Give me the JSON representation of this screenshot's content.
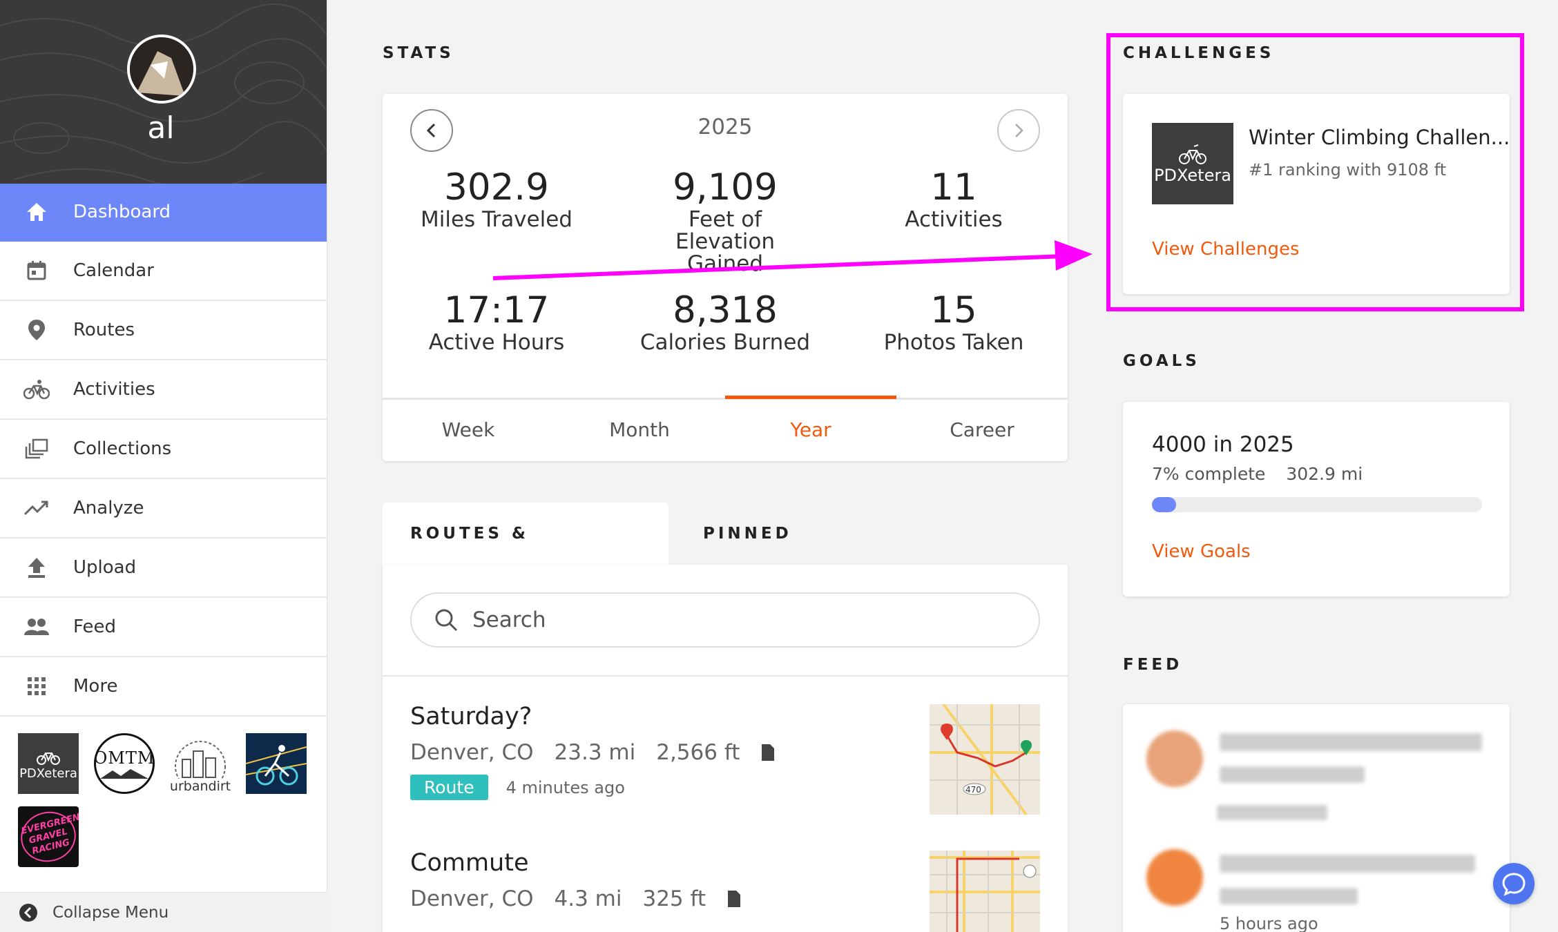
{
  "profile": {
    "username": "al"
  },
  "nav": [
    {
      "label": "Dashboard",
      "icon": "home-icon",
      "active": true
    },
    {
      "label": "Calendar",
      "icon": "calendar-icon"
    },
    {
      "label": "Routes",
      "icon": "map-pin-icon"
    },
    {
      "label": "Activities",
      "icon": "bike-icon"
    },
    {
      "label": "Collections",
      "icon": "collections-icon"
    },
    {
      "label": "Analyze",
      "icon": "trend-icon"
    },
    {
      "label": "Upload",
      "icon": "upload-icon"
    },
    {
      "label": "Feed",
      "icon": "people-icon"
    },
    {
      "label": "More",
      "icon": "grid-icon"
    }
  ],
  "clubs": [
    {
      "name": "PDXetera",
      "bg": "#3d3d3d"
    },
    {
      "name": "OMTM",
      "bg": "#ffffff"
    },
    {
      "name": "urbandirt",
      "bg": "#ffffff"
    },
    {
      "name": "",
      "bg": "#0d2a4a"
    },
    {
      "name": "EVERGREEN GRAVEL RACING",
      "bg": "#111111"
    }
  ],
  "collapse_label": "Collapse Menu",
  "stats": {
    "title": "STATS",
    "year": "2025",
    "items": [
      {
        "value": "302.9",
        "label": "Miles Traveled"
      },
      {
        "value": "9,109",
        "label": "Feet of Elevation Gained"
      },
      {
        "value": "11",
        "label": "Activities"
      },
      {
        "value": "17:17",
        "label": "Active Hours"
      },
      {
        "value": "8,318",
        "label": "Calories Burned"
      },
      {
        "value": "15",
        "label": "Photos Taken"
      }
    ],
    "tabs": [
      "Week",
      "Month",
      "Year",
      "Career"
    ],
    "selected_tab": "Year"
  },
  "routes": {
    "tabs": [
      "ROUTES & ACTIVITIES",
      "PINNED"
    ],
    "search_placeholder": "Search",
    "items": [
      {
        "title": "Saturday?",
        "location": "Denver, CO",
        "distance": "23.3 mi",
        "elevation": "2,566 ft",
        "badge": "Route",
        "time": "4 minutes ago"
      },
      {
        "title": "Commute",
        "location": "Denver, CO",
        "distance": "4.3 mi",
        "elevation": "325 ft"
      }
    ]
  },
  "challenges": {
    "title": "CHALLENGES",
    "name": "Winter Climbing Challen...",
    "club": "PDXetera",
    "ranking": "#1 ranking with 9108 ft",
    "link": "View Challenges"
  },
  "goals": {
    "title": "GOALS",
    "name": "4000 in 2025",
    "percent_text": "7% complete",
    "distance": "302.9 mi",
    "progress": 0.07,
    "link": "View Goals"
  },
  "feed": {
    "title": "FEED",
    "time": "5 hours ago"
  },
  "colors": {
    "accent": "#f15a0c",
    "nav_active": "#6d86f8",
    "annotation": "#ff00ff",
    "route_badge": "#2fbfbd"
  }
}
